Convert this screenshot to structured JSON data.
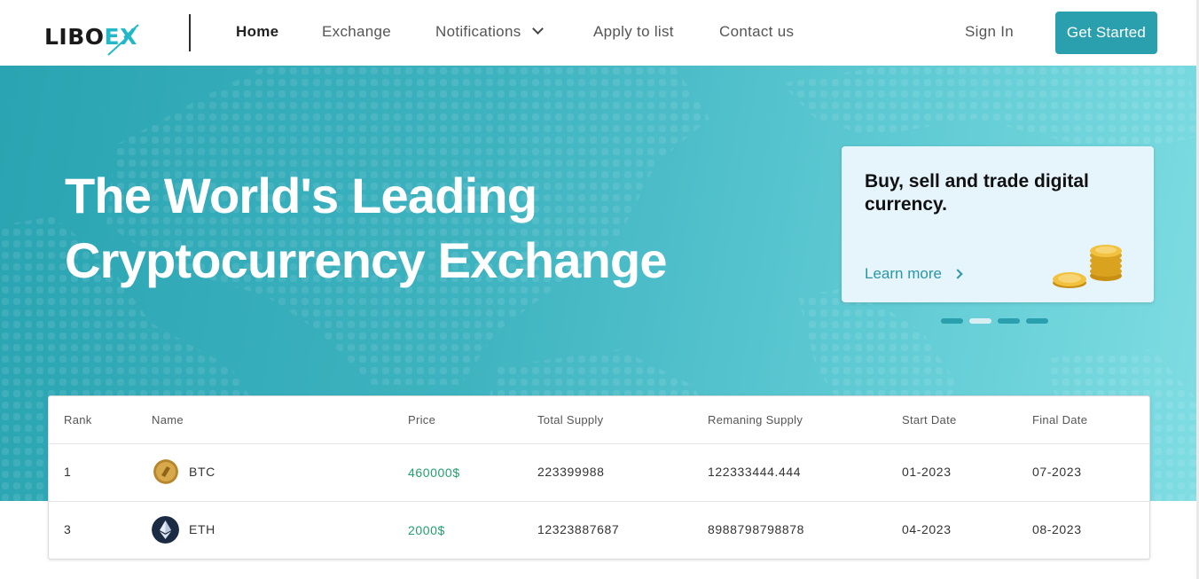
{
  "nav": {
    "logo_main": "LIBO",
    "logo_accent": "EX",
    "links": [
      {
        "label": "Home",
        "active": true
      },
      {
        "label": "Exchange",
        "active": false
      },
      {
        "label": "Notifications",
        "active": false
      },
      {
        "label": "Apply to list",
        "active": false
      },
      {
        "label": "Contact us",
        "active": false
      }
    ],
    "sign_in": "Sign In",
    "get_started": "Get Started"
  },
  "hero": {
    "title_line1": "The World's Leading",
    "title_line2": "Cryptocurrency Exchange",
    "promo": {
      "title": "Buy, sell and trade digital currency.",
      "link": "Learn more"
    },
    "slides": {
      "count": 4,
      "active": 2
    }
  },
  "table": {
    "headers": [
      "Rank",
      "Name",
      "Price",
      "Total Supply",
      "Remaning Supply",
      "Start Date",
      "Final Date"
    ],
    "rows": [
      {
        "rank": "1",
        "name": "BTC",
        "icon": "btc-coin-icon",
        "price": "460000$",
        "total_supply": "223399988",
        "remaining_supply": "122333444.444",
        "start_date": "01-2023",
        "final_date": "07-2023"
      },
      {
        "rank": "3",
        "name": "ETH",
        "icon": "eth-coin-icon",
        "price": "2000$",
        "total_supply": "12323887687",
        "remaining_supply": "8988798798878",
        "start_date": "04-2023",
        "final_date": "08-2023"
      }
    ]
  },
  "colors": {
    "accent": "#2a9fad",
    "hero_start": "#2aa4b2",
    "hero_end": "#7fdde3",
    "price_green": "#22a06b",
    "promo_bg": "#e6f4fb"
  }
}
